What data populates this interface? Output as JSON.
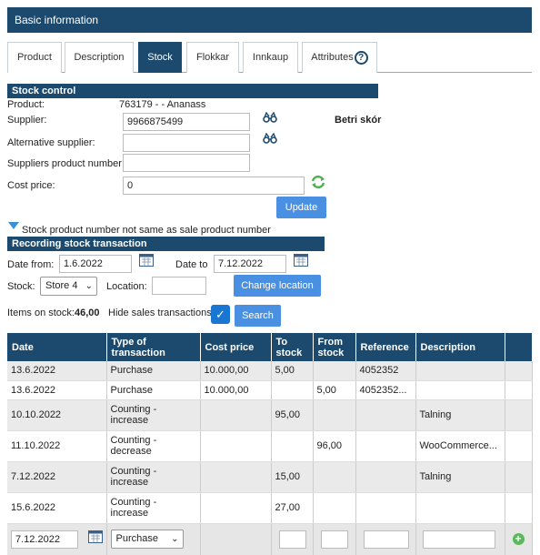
{
  "title": "Basic information",
  "tabs": [
    {
      "label": "Product"
    },
    {
      "label": "Description"
    },
    {
      "label": "Stock"
    },
    {
      "label": "Flokkar"
    },
    {
      "label": "Innkaup"
    },
    {
      "label": "Attributes"
    }
  ],
  "stock_control": {
    "heading": "Stock control",
    "product_label": "Product:",
    "product_value": "763179 - - Ananass",
    "supplier_label": "Supplier:",
    "supplier_value": "9966875499",
    "supplier_name": "Betri skór",
    "alt_supplier_label": "Alternative supplier:",
    "alt_supplier_value": "",
    "supplier_product_number_label": "Suppliers product number:",
    "supplier_product_number_value": "",
    "cost_price_label": "Cost price:",
    "cost_price_value": "0",
    "update_label": "Update",
    "notice": "Stock product number not same as sale product number"
  },
  "recording": {
    "heading": "Recording stock transaction",
    "date_from_label": "Date from:",
    "date_from_value": "1.6.2022",
    "date_to_label": "Date to",
    "date_to_value": "7.12.2022",
    "stock_label": "Stock:",
    "stock_value": "Store 4",
    "location_label": "Location:",
    "location_value": "",
    "change_location_label": "Change location",
    "items_on_stock_label": "Items on stock:",
    "items_on_stock_value": "46,00",
    "hide_sales_label": "Hide sales transactions:",
    "hide_sales_checked": true,
    "search_label": "Search"
  },
  "table": {
    "columns": [
      "Date",
      "Type of transaction",
      "Cost price",
      "To stock",
      "From stock",
      "Reference",
      "Description",
      ""
    ],
    "rows": [
      {
        "date": "13.6.2022",
        "type": "Purchase",
        "cost": "10.000,00",
        "to": "5,00",
        "from": "",
        "ref": "4052352",
        "desc": ""
      },
      {
        "date": "13.6.2022",
        "type": "Purchase",
        "cost": "10.000,00",
        "to": "",
        "from": "5,00",
        "ref": "4052352...",
        "desc": ""
      },
      {
        "date": "10.10.2022",
        "type": "Counting - increase",
        "cost": "",
        "to": "95,00",
        "from": "",
        "ref": "",
        "desc": "Talning"
      },
      {
        "date": "11.10.2022",
        "type": "Counting - decrease",
        "cost": "",
        "to": "",
        "from": "96,00",
        "ref": "",
        "desc": "WooCommerce..."
      },
      {
        "date": "7.12.2022",
        "type": "Counting - increase",
        "cost": "",
        "to": "15,00",
        "from": "",
        "ref": "",
        "desc": "Talning"
      },
      {
        "date": "15.6.2022",
        "type": "Counting - increase",
        "cost": "",
        "to": "27,00",
        "from": "",
        "ref": "",
        "desc": ""
      }
    ],
    "new_row": {
      "date": "7.12.2022",
      "type": "Purchase"
    }
  }
}
